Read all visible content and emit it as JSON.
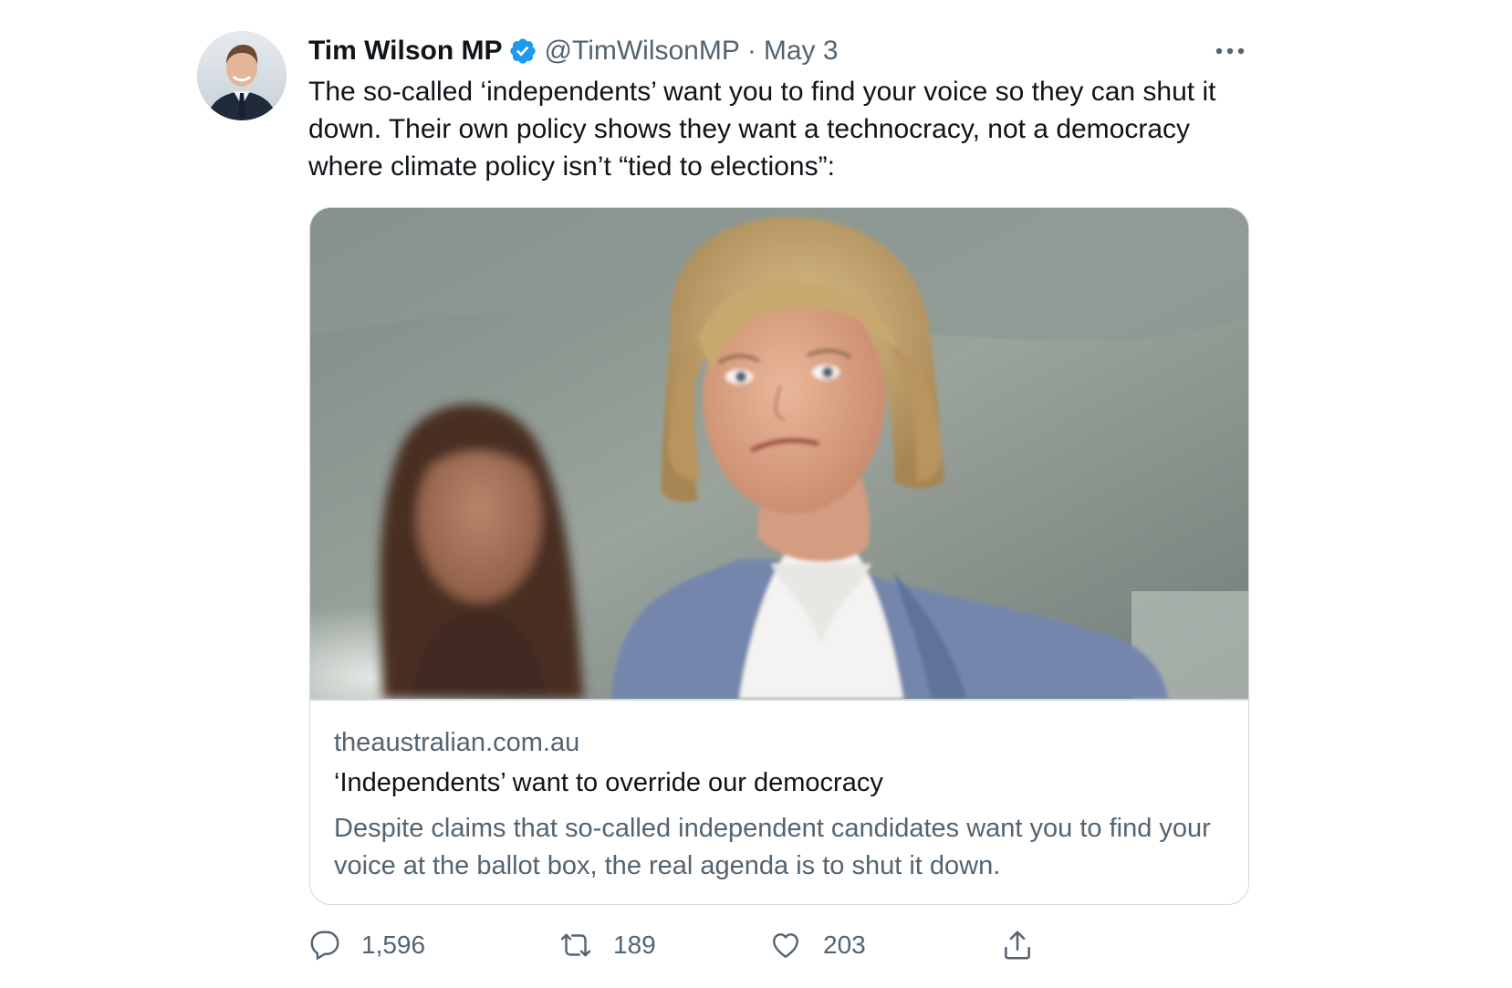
{
  "author": {
    "display_name": "Tim Wilson MP",
    "handle": "@TimWilsonMP",
    "separator": "·",
    "date": "May 3",
    "verified": true,
    "avatar_icon": "profile-photo"
  },
  "tweet": {
    "text": "The so-called ‘independents’ want you to find your voice so they can shut it down. Their own policy shows they want a technocracy, not a democracy where climate policy isn’t “tied to elections”:"
  },
  "card": {
    "domain": "theaustralian.com.au",
    "title": "‘Independents’ want to override our democracy",
    "description": "Despite claims that so-called independent candidates want you to find your voice at the ballot box, the real agenda is to shut it down.",
    "image_icon": "article-photo"
  },
  "actions": {
    "reply": {
      "icon": "reply-icon",
      "count": "1,596"
    },
    "retweet": {
      "icon": "retweet-icon",
      "count": "189"
    },
    "like": {
      "icon": "heart-icon",
      "count": "203"
    },
    "share": {
      "icon": "share-icon"
    }
  },
  "colors": {
    "text_primary": "#0f1419",
    "text_secondary": "#536471",
    "verified_blue": "#1d9bf0",
    "border": "#cfd9de"
  }
}
